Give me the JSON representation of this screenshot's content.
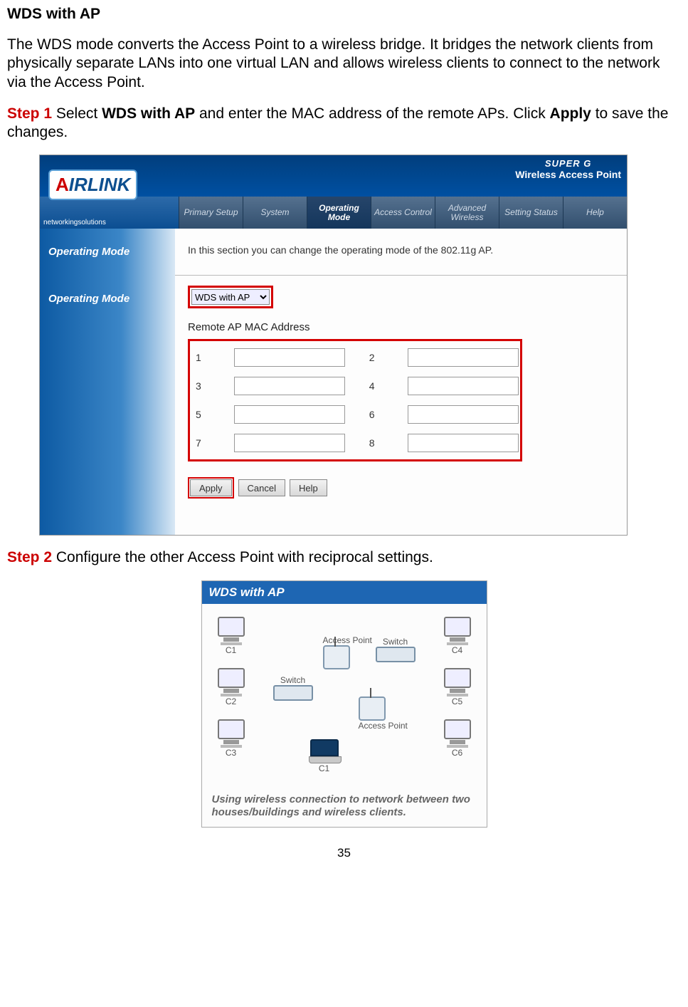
{
  "doc": {
    "heading": "WDS with AP",
    "intro": "The WDS mode converts the Access Point to a wireless bridge. It bridges the network clients from physically separate LANs into one virtual LAN and allows wireless clients to connect to the network via the Access Point.",
    "step1_label": "Step 1",
    "step1_a": " Select ",
    "step1_bold1": "WDS with AP",
    "step1_b": " and enter the MAC address of the remote APs. Click ",
    "step1_bold2": "Apply",
    "step1_c": " to save the changes.",
    "step2_label": "Step 2",
    "step2_text": " Configure the other Access Point with reciprocal settings.",
    "page_number": "35"
  },
  "router": {
    "brand_line1": "SUPER G",
    "brand_line2": "Wireless Access Point",
    "logo_text_a": "A",
    "logo_text_rest": "IRLINK",
    "logo_sub": "networkingsolutions",
    "nav": {
      "primary_setup": "Primary Setup",
      "system": "System",
      "operating_mode": "Operating Mode",
      "access_control": "Access Control",
      "advanced_wireless": "Advanced Wireless",
      "setting_status": "Setting Status",
      "help": "Help"
    },
    "section1_label": "Operating Mode",
    "section1_body": "In this section you can change the operating mode of the 802.11g AP.",
    "section2_label": "Operating Mode",
    "mode_value": "WDS with AP",
    "remote_heading": "Remote AP MAC Address",
    "mac": {
      "n1": "1",
      "n2": "2",
      "n3": "3",
      "n4": "4",
      "n5": "5",
      "n6": "6",
      "n7": "7",
      "n8": "8"
    },
    "buttons": {
      "apply": "Apply",
      "cancel": "Cancel",
      "help": "Help"
    }
  },
  "diagram": {
    "title": "WDS with AP",
    "labels": {
      "c1": "C1",
      "c2": "C2",
      "c3": "C3",
      "c4": "C4",
      "c5": "C5",
      "c6": "C6",
      "c1_laptop": "C1",
      "switch": "Switch",
      "ap": "Access Point"
    },
    "caption": "Using wireless connection to network between two houses/buildings and wireless clients."
  }
}
